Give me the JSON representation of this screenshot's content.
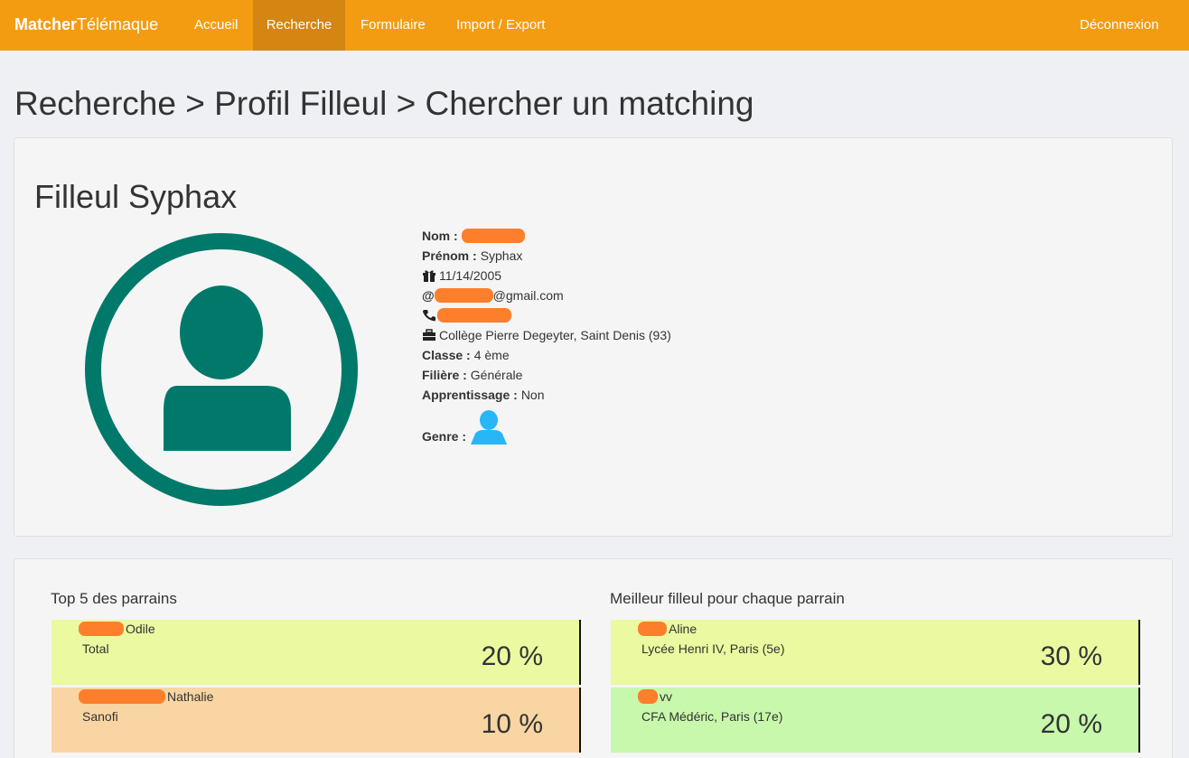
{
  "navbar": {
    "brand_bold": "Matcher",
    "brand_rest": "Télémaque",
    "links": [
      "Accueil",
      "Recherche",
      "Formulaire",
      "Import / Export"
    ],
    "logout": "Déconnexion",
    "active_link": "Recherche",
    "color": "#f39c12",
    "active_color": "#d58512"
  },
  "page_title": "Recherche > Profil Filleul > Chercher un matching",
  "profile": {
    "title": "Filleul Syphax",
    "avatar_icon": "user-circle-icon",
    "avatar_color": "#00796b",
    "nom_label": "Nom :",
    "prenom_label": "Prénom :",
    "prenom_value": "Syphax",
    "birthdate": "11/14/2005",
    "email_prefix": "@",
    "email_domain": "@gmail.com",
    "school": "Collège Pierre Degeyter, Saint Denis (93)",
    "classe_label": "Classe :",
    "classe_value": "4 ème",
    "filiere_label": "Filière :",
    "filiere_value": "Générale",
    "apprentissage_label": "Apprentissage :",
    "apprentissage_value": "Non",
    "genre_label": "Genre :",
    "genre_icon": "male-user-icon",
    "redaction_color": "#fd7f2c"
  },
  "top_parrains": {
    "title": "Top 5 des parrains",
    "items": [
      {
        "name": "Odile",
        "company": "Total",
        "score": "20 %",
        "color": "#ebf9a0"
      },
      {
        "name": "Nathalie",
        "company": "Sanofi",
        "score": "10 %",
        "color": "#f8d5a2"
      }
    ]
  },
  "best_filleuls": {
    "title": "Meilleur filleul pour chaque parrain",
    "items": [
      {
        "name": "Aline",
        "school": "Lycée Henri IV, Paris (5e)",
        "score": "30 %",
        "color": "#ebf9a0"
      },
      {
        "name": "vv",
        "school": "CFA Médéric, Paris (17e)",
        "score": "20 %",
        "color": "#c8f8ab"
      }
    ]
  }
}
